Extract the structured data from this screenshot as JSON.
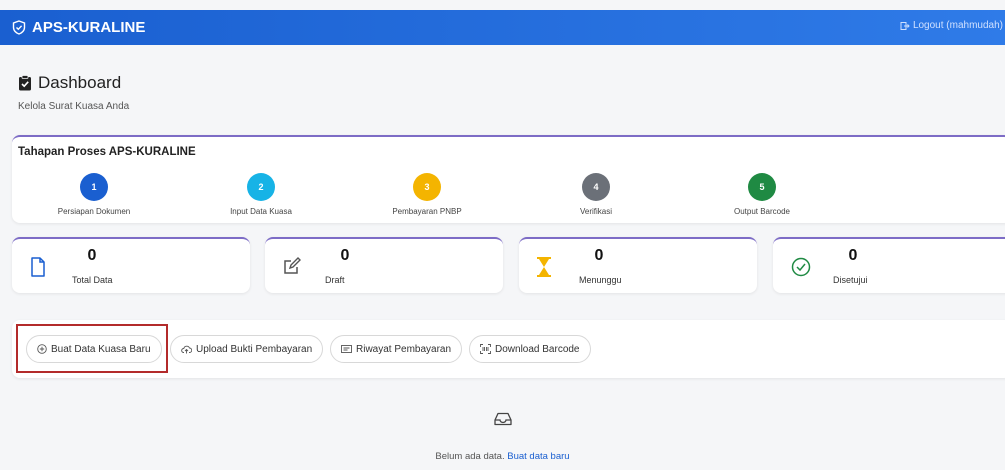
{
  "app": {
    "brand": "APS-KURALINE",
    "logout": "Logout (mahmudah)"
  },
  "page": {
    "title": "Dashboard",
    "subtitle": "Kelola Surat Kuasa Anda"
  },
  "process": {
    "title": "Tahapan Proses APS-KURALINE",
    "steps": [
      {
        "number": "1",
        "label": "Persiapan Dokumen",
        "color": "#1a5fd0"
      },
      {
        "number": "2",
        "label": "Input Data Kuasa",
        "color": "#17b3e6"
      },
      {
        "number": "3",
        "label": "Pembayaran PNBP",
        "color": "#f4b400"
      },
      {
        "number": "4",
        "label": "Verifikasi",
        "color": "#6b7078"
      },
      {
        "number": "5",
        "label": "Output Barcode",
        "color": "#1f8a43"
      }
    ]
  },
  "stats": [
    {
      "value": "0",
      "label": "Total Data",
      "icon": "document-icon",
      "color": "#1a5fd0"
    },
    {
      "value": "0",
      "label": "Draft",
      "icon": "edit-icon",
      "color": "#555555"
    },
    {
      "value": "0",
      "label": "Menunggu",
      "icon": "hourglass-icon",
      "color": "#f4b400"
    },
    {
      "value": "0",
      "label": "Disetujui",
      "icon": "check-circle-icon",
      "color": "#1f8a43"
    }
  ],
  "actions": [
    {
      "label": "Buat Data Kuasa Baru",
      "icon": "plus-circle-icon"
    },
    {
      "label": "Upload Bukti Pembayaran",
      "icon": "cloud-upload-icon"
    },
    {
      "label": "Riwayat Pembayaran",
      "icon": "history-icon"
    },
    {
      "label": "Download Barcode",
      "icon": "barcode-icon"
    }
  ],
  "empty": {
    "text": "Belum ada data.",
    "link": "Buat data baru",
    "icon": "inbox-icon"
  }
}
